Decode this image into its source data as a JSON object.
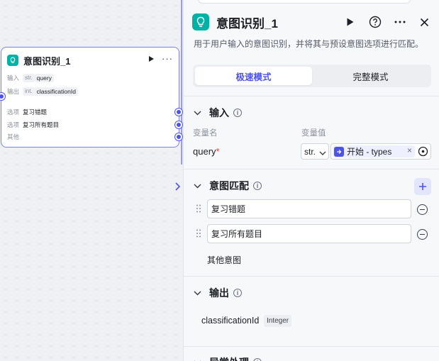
{
  "canvas_node": {
    "title": "意图识别_1",
    "input_label": "输入",
    "input_type": "str.",
    "input_name": "query",
    "output_label": "输出",
    "output_type": "int.",
    "output_name": "classificationId",
    "options": [
      {
        "label": "选项",
        "value": "复习错题"
      },
      {
        "label": "选项",
        "value": "复习所有题目"
      },
      {
        "label": "其他",
        "value": ""
      }
    ]
  },
  "panel": {
    "title": "意图识别_1",
    "description": "用于用户输入的意图识别，并将其与预设意图选项进行匹配。",
    "modes": [
      {
        "label": "极速模式",
        "active": true
      },
      {
        "label": "完整模式",
        "active": false
      }
    ],
    "input_section": {
      "label": "输入",
      "col_name": "变量名",
      "col_value": "变量值",
      "var_name": "query",
      "required_mark": "*",
      "type_value": "str.",
      "ref_label": "开始 - types"
    },
    "intent_section": {
      "label": "意图匹配",
      "intents": [
        "复习错题",
        "复习所有题目"
      ],
      "other_label": "其他意图"
    },
    "output_section": {
      "label": "输出",
      "var_name": "classificationId",
      "var_type": "Integer"
    },
    "next_section": {
      "label": "异常处理"
    }
  },
  "colors": {
    "accent": "#4d53e8",
    "node_logo": "#00b2a5",
    "required": "#e53935"
  }
}
